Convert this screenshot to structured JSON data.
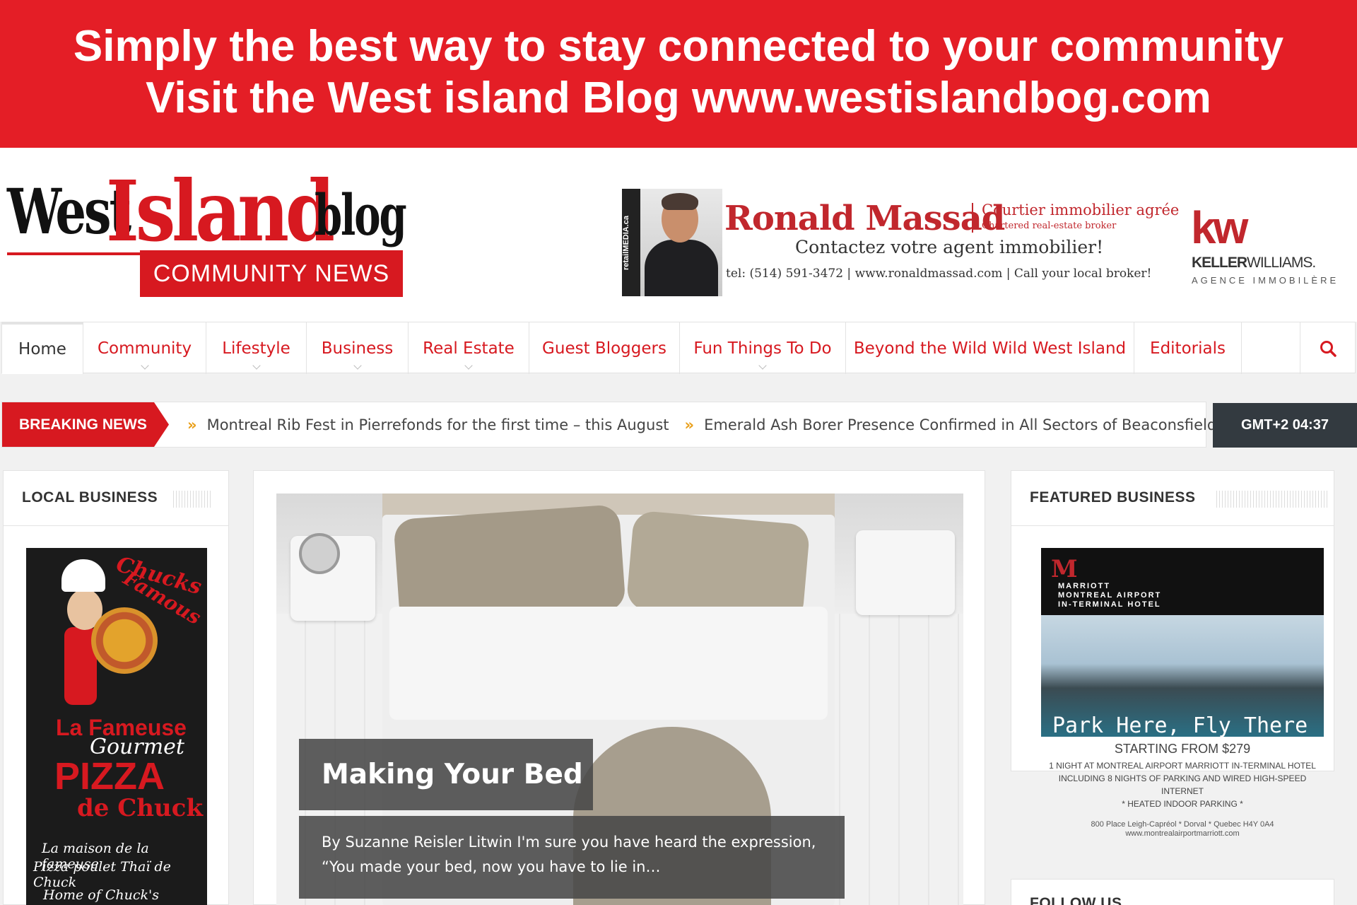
{
  "promo": {
    "line1": "Simply the best way to stay connected to your community",
    "line2": "Visit the West island Blog www.westislandbog.com"
  },
  "logo": {
    "word1": "West",
    "word2": "Island",
    "word3": "blog",
    "tagline": "COMMUNITY NEWS"
  },
  "ad": {
    "vertical_text": "retailMEDIA.ca",
    "name": "Ronald Massad",
    "courtier": "Courtier immobilier agrée",
    "chartered": "Chartered real-estate broker",
    "contact": "Contactez votre agent immobilier!",
    "tel_line": "tel: (514) 591-3472  |  www.ronaldmassad.com  |  Call your local broker!",
    "kw": "kw",
    "kw_name_bold": "KELLER",
    "kw_name_rest": "WILLIAMS.",
    "agence": "AGENCE IMMOBILÈRE"
  },
  "nav": {
    "items": [
      {
        "label": "Home"
      },
      {
        "label": "Community"
      },
      {
        "label": "Lifestyle"
      },
      {
        "label": "Business"
      },
      {
        "label": "Real Estate"
      },
      {
        "label": "Guest Bloggers"
      },
      {
        "label": "Fun Things To Do"
      },
      {
        "label": "Beyond the Wild Wild West Island"
      },
      {
        "label": "Editorials"
      }
    ],
    "search_icon": "search-icon"
  },
  "breaking": {
    "label": "BREAKING NEWS",
    "items": [
      "Montreal Rib Fest in Pierrefonds for the first time – this August",
      "Emerald Ash Borer Presence Confirmed in All Sectors of Beaconsfield"
    ],
    "arrow": "»",
    "clock": "GMT+2 04:37"
  },
  "local_business": {
    "title": "LOCAL BUSINESS",
    "ad": {
      "brand_line1": "Chucks",
      "brand_line2": "Famous",
      "t1": "La Fameuse",
      "t2": "Gourmet",
      "t3": "PIZZA",
      "t4": "de Chuck",
      "s1": "La maison de la fameuse",
      "s2": "Pizza poulet Thaï de Chuck",
      "s3": "Home of Chuck's famous"
    }
  },
  "feature": {
    "title": "Making Your Bed",
    "excerpt": "By  Suzanne Reisler Litwin I'm sure you have heard the expression, “You made your bed, now you have to lie in…"
  },
  "featured_business": {
    "title": "FEATURED BUSINESS",
    "ad": {
      "logo": "M",
      "hotel_line1": "MARRIOTT",
      "hotel_line2": "MONTREAL AIRPORT",
      "hotel_line3": "IN-TERMINAL HOTEL",
      "slogan": "Park Here, Fly There",
      "price": "STARTING FROM $279",
      "detail1": "1 NIGHT AT MONTREAL AIRPORT MARRIOTT IN-TERMINAL HOTEL",
      "detail2": "INCLUDING 8 NIGHTS OF PARKING AND WIRED HIGH-SPEED INTERNET",
      "detail3": "* HEATED INDOOR PARKING *",
      "address": "800 Place Leigh-Capréol * Dorval * Quebec H4Y 0A4",
      "url": "www.montrealairportmarriott.com"
    }
  },
  "follow": {
    "title": "FOLLOW US"
  },
  "colors": {
    "brand_red": "#d71920",
    "banner_red": "#e41e26",
    "clock_bg": "#333a40",
    "ticker_arrow": "#e9a01c"
  }
}
